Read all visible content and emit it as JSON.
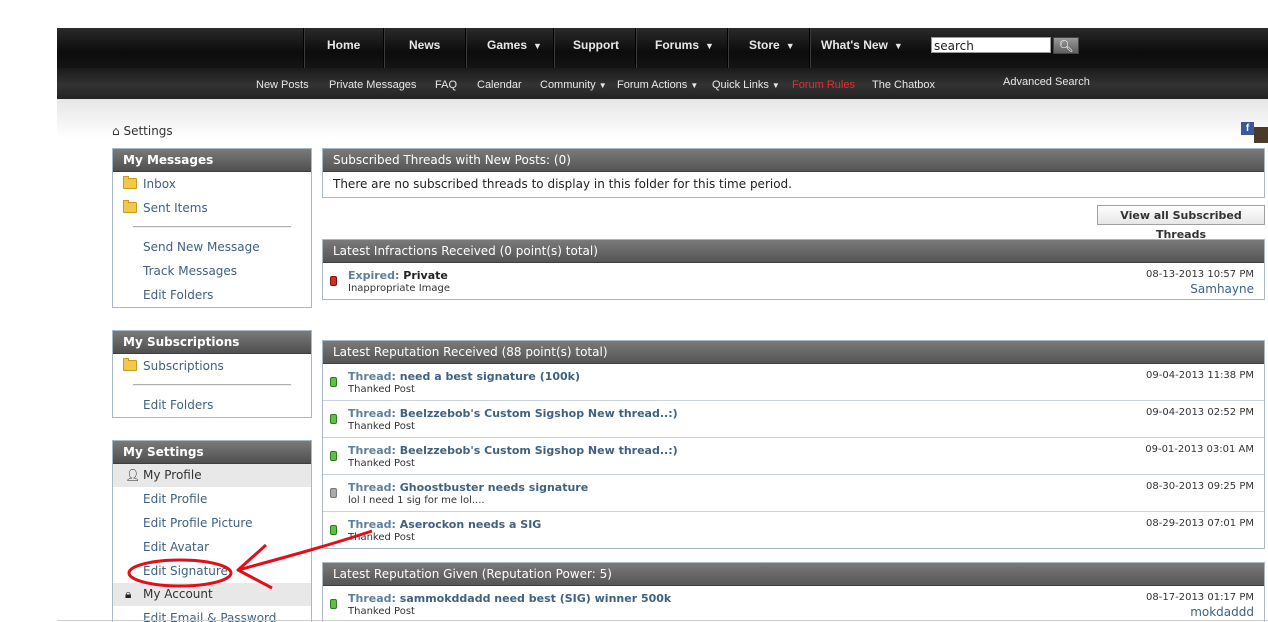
{
  "nav_main": {
    "items": [
      "Home",
      "News",
      "Games",
      "Support",
      "Forums",
      "Store",
      "What's New"
    ],
    "search_value": "search"
  },
  "nav_sub": {
    "items": [
      "New Posts",
      "Private Messages",
      "FAQ",
      "Calendar",
      "Community",
      "Forum Actions",
      "Quick Links",
      "Forum Rules",
      "The Chatbox",
      "Advanced Search"
    ]
  },
  "breadcrumb": "Settings",
  "facebook_label": "f",
  "sidebar": {
    "messages": {
      "title": "My Messages",
      "folders": [
        "Inbox",
        "Sent Items"
      ],
      "links": [
        "Send New Message",
        "Track Messages",
        "Edit Folders"
      ]
    },
    "subscriptions": {
      "title": "My Subscriptions",
      "folders": [
        "Subscriptions"
      ],
      "links": [
        "Edit Folders"
      ]
    },
    "settings": {
      "title": "My Settings",
      "profile_label": "My Profile",
      "profile_links": [
        "Edit Profile",
        "Edit Profile Picture",
        "Edit Avatar",
        "Edit Signature"
      ],
      "account_label": "My Account",
      "account_links": [
        "Edit Email & Password"
      ]
    }
  },
  "subscribed": {
    "title": "Subscribed Threads with New Posts: (0)",
    "empty_text": "There are no subscribed threads to display in this folder for this time period.",
    "view_all_label": "View all Subscribed Threads"
  },
  "infractions": {
    "title": "Latest Infractions Received (0 point(s) total)",
    "entries": [
      {
        "prefix": "Expired:",
        "name": "Private",
        "sub": "Inappropriate Image",
        "date": "08-13-2013 10:57 PM",
        "user": "Samhayne",
        "status_color": "#d62b1f"
      }
    ]
  },
  "rep_received": {
    "title": "Latest Reputation Received (88 point(s) total)",
    "entries": [
      {
        "prefix": "Thread:",
        "name": "need a best signature (100k)",
        "sub": "Thanked Post",
        "date": "09-04-2013 11:38 PM"
      },
      {
        "prefix": "Thread:",
        "name": "Beelzzebob's Custom Sigshop New thread..:)",
        "sub": "Thanked Post",
        "date": "09-04-2013 02:52 PM"
      },
      {
        "prefix": "Thread:",
        "name": "Beelzzebob's Custom Sigshop New thread..:)",
        "sub": "Thanked Post",
        "date": "09-01-2013 03:01 AM"
      },
      {
        "prefix": "Thread:",
        "name": "Ghoostbuster needs signature",
        "sub": "lol I need 1 sig for me lol....",
        "date": "08-30-2013 09:25 PM",
        "neutral": true
      },
      {
        "prefix": "Thread:",
        "name": "Aserockon needs a SIG",
        "sub": "Thanked Post",
        "date": "08-29-2013 07:01 PM"
      }
    ]
  },
  "rep_given": {
    "title": "Latest Reputation Given (Reputation Power: 5)",
    "entries": [
      {
        "prefix": "Thread:",
        "name": "sammokddadd need best (SIG) winner 500k",
        "sub": "Thanked Post",
        "date": "08-17-2013 01:17 PM",
        "user": "mokdaddd"
      }
    ]
  },
  "colors": {
    "link": "#3f6183",
    "header_bg": "#5f5f5f",
    "positive": "#5bc33f",
    "infraction": "#d62b1f",
    "annotation": "#e0101a"
  }
}
